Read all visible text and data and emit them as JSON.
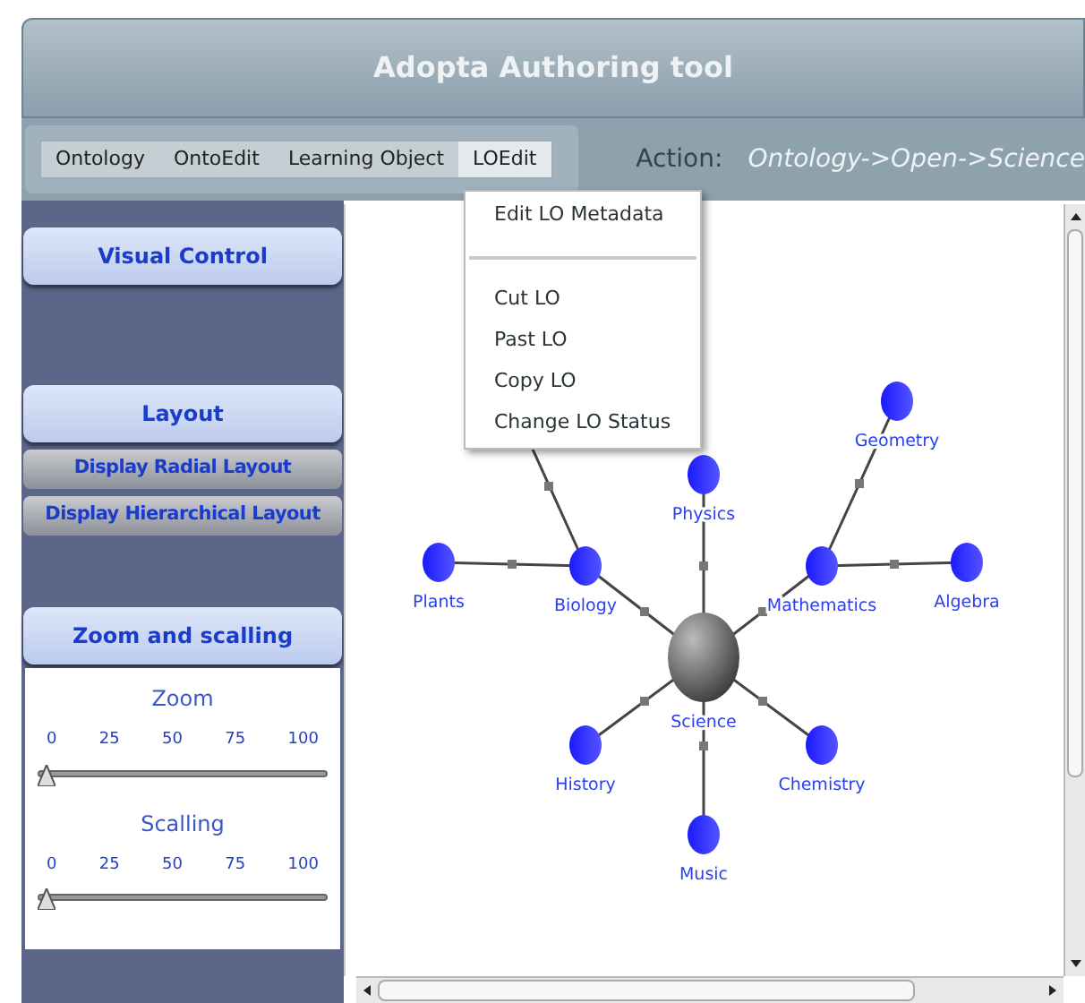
{
  "window": {
    "title": "Adopta Authoring tool"
  },
  "menu_bar": [
    {
      "label": "Ontology",
      "selected": false
    },
    {
      "label": "OntoEdit",
      "selected": false
    },
    {
      "label": "Learning Object",
      "selected": false
    },
    {
      "label": "LOEdit",
      "selected": true
    }
  ],
  "action": {
    "label": "Action:",
    "value": "Ontology->Open->Science"
  },
  "dropdown": [
    {
      "kind": "item",
      "label": "Edit LO Metadata"
    },
    {
      "kind": "separator"
    },
    {
      "kind": "item",
      "label": "Cut LO"
    },
    {
      "kind": "item",
      "label": "Past LO"
    },
    {
      "kind": "item",
      "label": "Copy LO"
    },
    {
      "kind": "item",
      "label": "Change LO Status"
    }
  ],
  "sidebar": {
    "visual_control": "Visual Control",
    "layout": "Layout",
    "layout_buttons": [
      "Display Radial Layout",
      "Display Hierarchical Layout"
    ],
    "zoom_section": "Zoom and scalling",
    "sliders": [
      {
        "label": "Zoom",
        "ticks": [
          "0",
          "25",
          "50",
          "75",
          "100"
        ],
        "level": 0
      },
      {
        "label": "Scalling",
        "ticks": [
          "0",
          "25",
          "50",
          "75",
          "100"
        ],
        "level": 0
      }
    ]
  },
  "graph": {
    "label": "Science",
    "children": [
      {
        "label": "Biology",
        "children": [
          {
            "label": "Plants"
          }
        ]
      },
      {
        "label": "Physics"
      },
      {
        "label": "Mathematics",
        "children": [
          {
            "label": "Geometry"
          },
          {
            "label": "Algebra"
          }
        ]
      },
      {
        "label": "History"
      },
      {
        "label": "Chemistry"
      },
      {
        "label": "Music"
      }
    ]
  }
}
